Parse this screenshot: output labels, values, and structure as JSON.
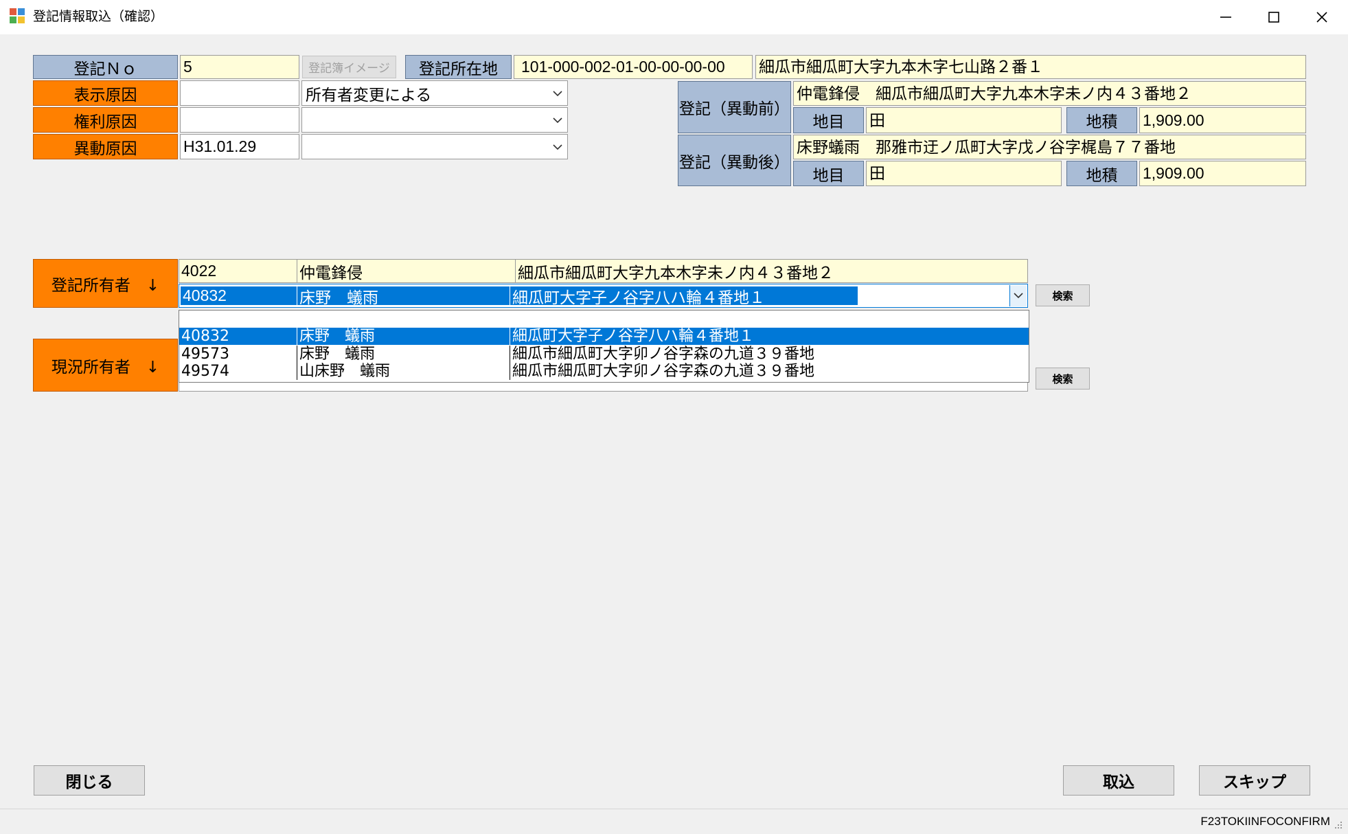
{
  "window": {
    "title": "登記情報取込（確認）"
  },
  "form": {
    "labels": {
      "registry_no": "登記Ｎｏ",
      "display_cause": "表示原因",
      "rights_cause": "権利原因",
      "change_cause": "異動原因",
      "location": "登記所在地",
      "before": "登記（異動前）",
      "after": "登記（異動後）",
      "land_category": "地目",
      "land_area": "地積",
      "registered_owner": "登記所有者　↓",
      "current_owner": "現況所有者　↓"
    },
    "registry_no": "5",
    "registry_image_button": "登記簿イメージ",
    "location_code": "101-000-002-01-00-00-00-00",
    "location_address": "細瓜市細瓜町大字九本木字七山路２番１",
    "display_cause_code": "",
    "display_cause_value": "所有者変更による",
    "rights_cause_code": "",
    "rights_cause_value": "",
    "change_cause_date": "H31.01.29",
    "change_cause_value": "",
    "before": {
      "owner": "仲電鋒侵　細瓜市細瓜町大字九本木字未ノ内４３番地２",
      "land_category": "田",
      "land_area": "1,909.00"
    },
    "after": {
      "owner": "床野蟻雨　那雅市迂ノ瓜町大字戊ノ谷字梶島７７番地",
      "land_category": "田",
      "land_area": "1,909.00"
    }
  },
  "registered_owner": {
    "row": {
      "code": "4022",
      "name": "仲電鋒侵",
      "address": "細瓜市細瓜町大字九本木字未ノ内４３番地２"
    },
    "combo": {
      "code": "40832",
      "name": "床野　蟻雨",
      "address": "細瓜町大字子ノ谷字八ハ輪４番地１"
    },
    "search_button": "検索"
  },
  "dropdown": {
    "items": [
      {
        "code": "40832",
        "name": "床野　蟻雨",
        "address": "細瓜町大字子ノ谷字八ハ輪４番地１",
        "selected": true
      },
      {
        "code": "49573",
        "name": "床野　蟻雨",
        "address": "細瓜市細瓜町大字卯ノ谷字森の九道３９番地"
      },
      {
        "code": "49574",
        "name": "山床野　蟻雨",
        "address": "細瓜市細瓜町大字卯ノ谷字森の九道３９番地"
      }
    ]
  },
  "current_owner": {
    "search_button": "検索"
  },
  "footer": {
    "close_button": "閉じる",
    "import_button": "取込",
    "skip_button": "スキップ"
  },
  "status": {
    "form_id": "F23TOKIINFOCONFIRM"
  },
  "colors": {
    "label_blue": "#a9bcd6",
    "label_orange": "#ff8000",
    "field_yellow": "#fffdd9",
    "selection": "#0078d7"
  }
}
